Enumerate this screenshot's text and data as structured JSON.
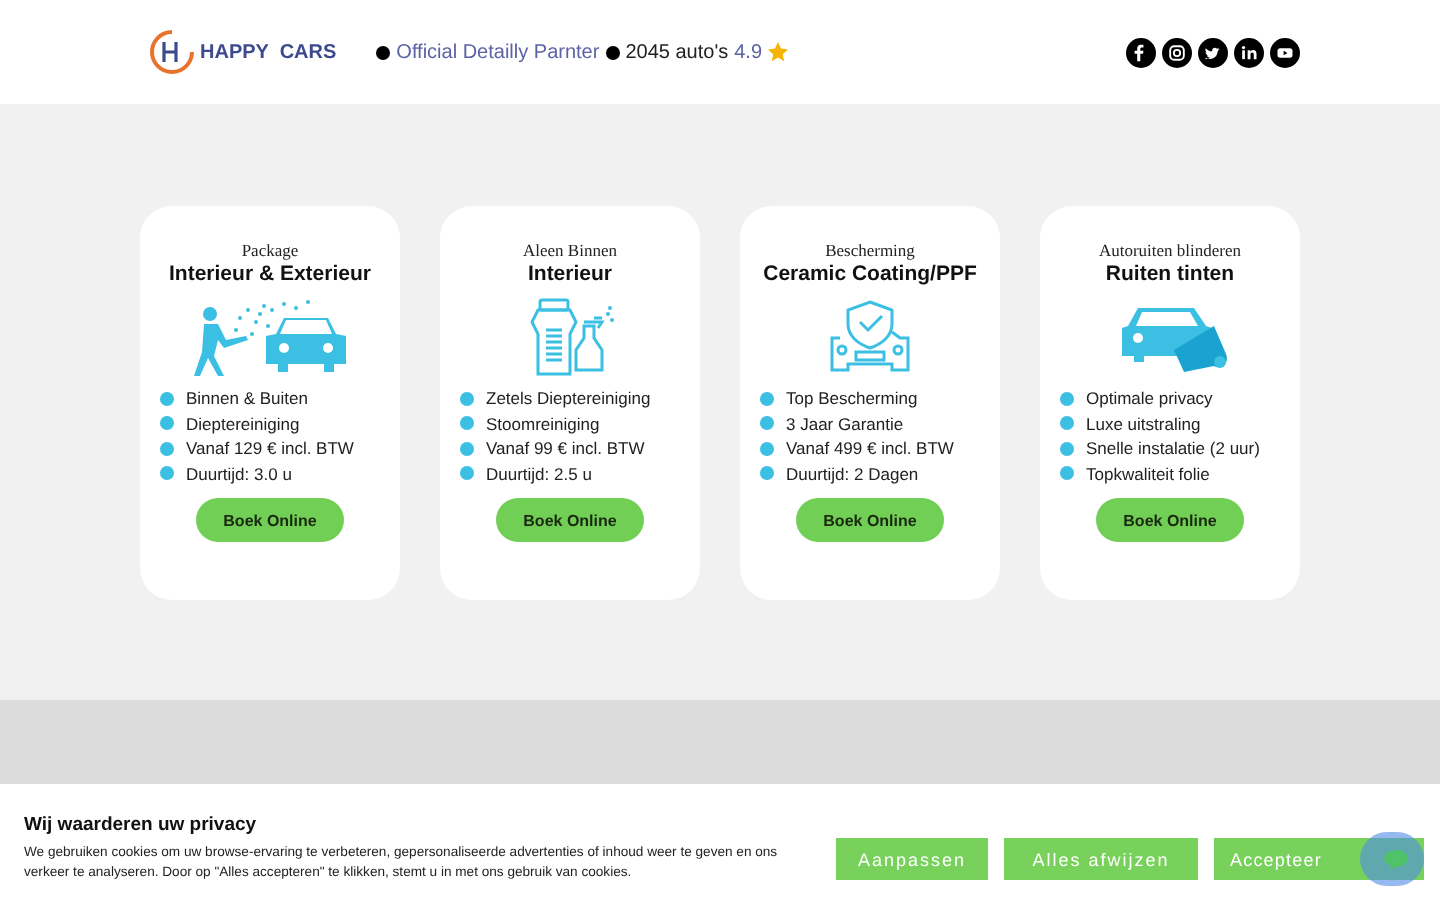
{
  "header": {
    "brand": "HAPPY  CARS",
    "partner": "Official Detailly Parnter",
    "cars": "2045 auto's",
    "rating": "4.9",
    "socials": [
      {
        "kind": "facebook"
      },
      {
        "kind": "instagram"
      },
      {
        "kind": "twitter"
      },
      {
        "kind": "linkedin"
      },
      {
        "kind": "youtube"
      }
    ]
  },
  "cards": [
    {
      "subtitle": "Package",
      "title": "Interieur & Exterieur",
      "kind": "wash",
      "features": [
        "Binnen & Buiten",
        "Dieptereiniging",
        "Vanaf 129 € incl. BTW",
        "Duurtijd: 3.0 u"
      ],
      "button": "Boek Online"
    },
    {
      "subtitle": "Aleen Binnen",
      "title": "Interieur",
      "kind": "interior",
      "features": [
        "Zetels Dieptereiniging",
        "Stoomreiniging",
        "Vanaf 99 € incl. BTW",
        "Duurtijd: 2.5 u"
      ],
      "button": "Boek Online"
    },
    {
      "subtitle": "Bescherming",
      "title": "Ceramic Coating/PPF",
      "kind": "shield",
      "features": [
        "Top Bescherming",
        "3 Jaar Garantie",
        "Vanaf 499 € incl. BTW",
        "Duurtijd: 2 Dagen"
      ],
      "button": "Boek Online"
    },
    {
      "subtitle": "Autoruiten blinderen",
      "title": "Ruiten tinten",
      "kind": "tint",
      "features": [
        "Optimale privacy",
        "Luxe uitstraling",
        "Snelle instalatie (2 uur)",
        "Topkwaliteit folie"
      ],
      "button": "Boek Online"
    }
  ],
  "cookie": {
    "title": "Wij waarderen uw privacy",
    "text": "We gebruiken cookies om uw browse-ervaring te verbeteren, gepersonaliseerde advertenties of inhoud weer te geven en ons verkeer te analyseren. Door op \"Alles accepteren\" te klikken, stemt u in met ons gebruik van cookies.",
    "buttons": [
      "Aanpassen",
      "Alles afwijzen",
      "Accepteer"
    ]
  }
}
